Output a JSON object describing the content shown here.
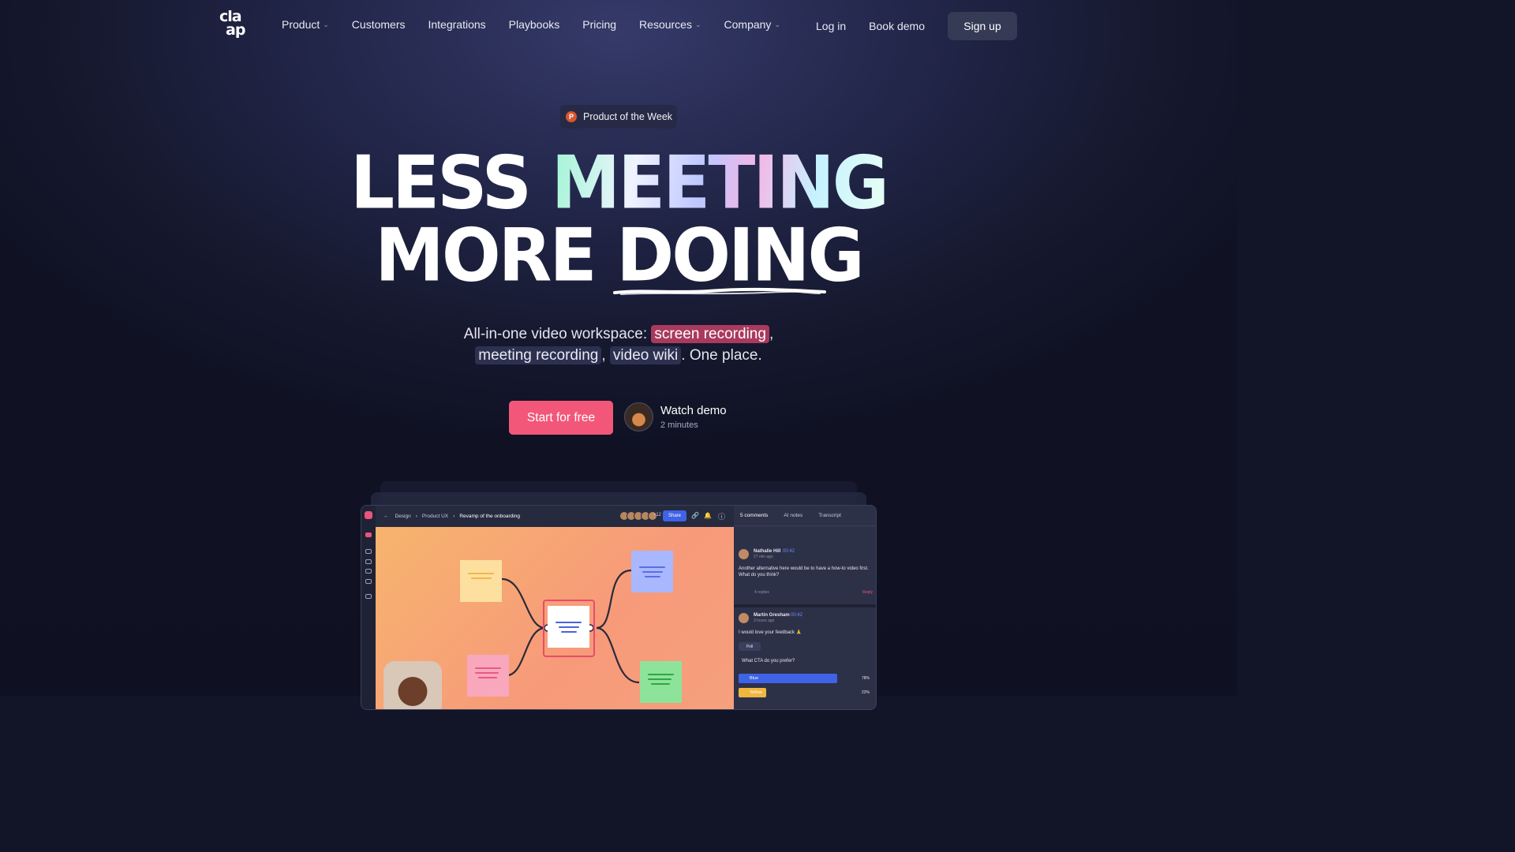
{
  "nav": {
    "logo_line1": "cla",
    "logo_line2": "ap",
    "items": [
      {
        "label": "Product",
        "dropdown": true
      },
      {
        "label": "Customers",
        "dropdown": false
      },
      {
        "label": "Integrations",
        "dropdown": false
      },
      {
        "label": "Playbooks",
        "dropdown": false
      },
      {
        "label": "Pricing",
        "dropdown": false
      },
      {
        "label": "Resources",
        "dropdown": true
      },
      {
        "label": "Company",
        "dropdown": true
      }
    ],
    "login": "Log in",
    "book_demo": "Book demo",
    "signup": "Sign up"
  },
  "badge": {
    "icon_letter": "P",
    "label": "Product of the Week"
  },
  "hero": {
    "line1_a": "LESS",
    "line1_b": "MEETING",
    "line2_a": "MORE",
    "line2_b": "DOING"
  },
  "subtitle": {
    "prefix": "All-in-one video workspace:",
    "hl1": "screen recording",
    "comma1": ",",
    "hl2": "meeting recording",
    "comma2": ",",
    "hl3": "video wiki",
    "suffix": ". One place."
  },
  "cta": {
    "start": "Start for free",
    "watch_title": "Watch demo",
    "watch_sub": "2 minutes"
  },
  "app": {
    "crumb1": "Design",
    "crumb2": "Product UX",
    "crumb3": "Revamp of the onboarding",
    "avatar_count": "+12",
    "share": "Share",
    "tab_comments": "5 comments",
    "tab_ai": "AI notes",
    "tab_transcript": "Transcript",
    "comment1_name": "Nathalie Hill",
    "comment1_time": "00:42",
    "comment1_ago": "27 min ago",
    "comment1_text": "Another alternative here would be to have a how-to video first. What do you think?",
    "comment1_replies": "4 replies",
    "comment1_reply": "Reply",
    "comment2_name": "Martin Gresham",
    "comment2_time": "00:42",
    "comment2_ago": "3 hours ago",
    "comment2_text": "I would love your feedback 🙏",
    "poll_label": "Poll",
    "poll_question": "What CTA do you prefer?",
    "poll_opt1": "Blue",
    "poll_opt1_pct": "78%",
    "poll_opt1_value": 0.78,
    "poll_opt2": "Yellow",
    "poll_opt2_pct": "22%",
    "poll_opt2_value": 0.22
  },
  "colors": {
    "accent": "#f2577a",
    "brand_bg": "#121428",
    "share_blue": "#3f63e6"
  }
}
